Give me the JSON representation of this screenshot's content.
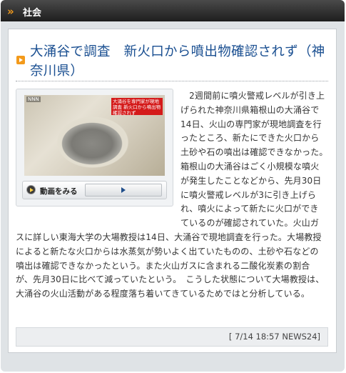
{
  "section": {
    "title": "社会"
  },
  "article": {
    "title": "大涌谷で調査　新火口から噴出物確認されず（神奈川県）",
    "body": "　2週間前に噴火警戒レベルが引き上げられた神奈川県箱根山の大涌谷で14日、火山の専門家が現地調査を行ったところ、新たにできた火口から土砂や石の噴出は確認できなかった。　箱根山の大涌谷はごく小規模な噴火が発生したことなどから、先月30日に噴火警戒レベルが3に引き上げられ、噴火によって新たに火口ができているのが確認されていた。火山ガスに詳しい東海大学の大場教授は14日、大涌谷で現地調査を行った。大場教授によると新たな火口からは水蒸気が勢いよく出ていたものの、土砂や石などの噴出は確認できなかったという。また火山ガスに含まれる二酸化炭素の割合が、先月30日に比べて減っていたという。　こうした状態について大場教授は、大涌谷の火山活動がある程度落ち着いてきているためではと分析している。",
    "video": {
      "watch_label": "動画をみる",
      "logo_text": "NNN",
      "caption_text": "大涌谷を専門家が現地調査 新火口から噴出物確認されず"
    },
    "footer": "[ 7/14 18:57 NEWS24]"
  }
}
